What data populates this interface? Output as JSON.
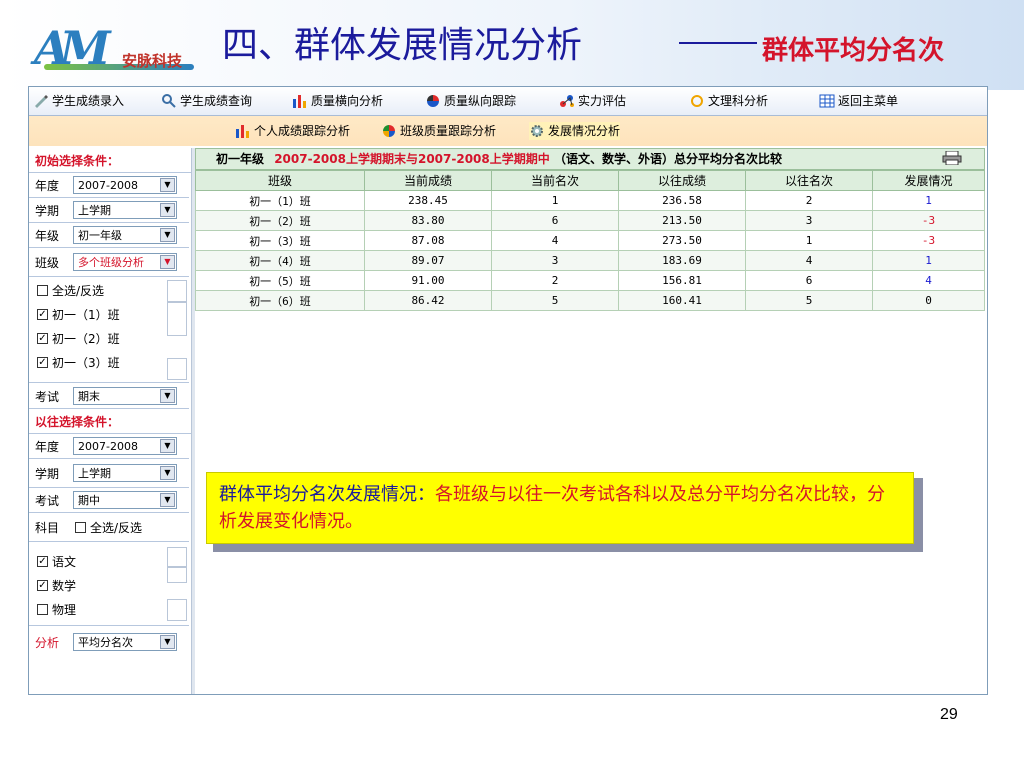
{
  "header": {
    "logo_mark": "AM",
    "logo_text": "安脉科技",
    "title": "四、群体发展情况分析",
    "subtitle": "群体平均分名次"
  },
  "toolbar": {
    "items": [
      {
        "label": "学生成绩录入"
      },
      {
        "label": "学生成绩查询"
      },
      {
        "label": "质量横向分析"
      },
      {
        "label": "质量纵向跟踪"
      },
      {
        "label": "实力评估"
      },
      {
        "label": "文理科分析"
      },
      {
        "label": "返回主菜单"
      }
    ]
  },
  "subtoolbar": {
    "items": [
      {
        "label": "个人成绩跟踪分析"
      },
      {
        "label": "班级质量跟踪分析"
      },
      {
        "label": "发展情况分析"
      }
    ]
  },
  "left": {
    "initial_head": "初始选择条件：",
    "year_label": "年度",
    "year_value": "2007-2008",
    "term_label": "学期",
    "term_value": "上学期",
    "grade_label": "年级",
    "grade_value": "初一年级",
    "class_label": "班级",
    "class_value": "多个班级分析",
    "select_all": "全选/反选",
    "classes": [
      "初一（1）班",
      "初一（2）班",
      "初一（3）班"
    ],
    "exam_label": "考试",
    "exam_value": "期末",
    "prev_head": "以往选择条件：",
    "prev_year_label": "年度",
    "prev_year_value": "2007-2008",
    "prev_term_label": "学期",
    "prev_term_value": "上学期",
    "prev_exam_label": "考试",
    "prev_exam_value": "期中",
    "subject_label": "科目",
    "subject_select_all": "全选/反选",
    "subjects": [
      "语文",
      "数学",
      "物理"
    ],
    "analysis_label": "分析",
    "analysis_value": "平均分名次"
  },
  "result": {
    "caption_grade": "初一年级",
    "caption_range": "2007-2008上学期期末与2007-2008上学期期中",
    "caption_tail": "（语文、数学、外语）总分平均分名次比较",
    "columns": [
      "班级",
      "当前成绩",
      "当前名次",
      "以往成绩",
      "以往名次",
      "发展情况"
    ],
    "rows": [
      {
        "cls": "初一（1）班",
        "cur_score": "238.45",
        "cur_rank": "1",
        "prev_score": "236.58",
        "prev_rank": "2",
        "dev": "1"
      },
      {
        "cls": "初一（2）班",
        "cur_score": "83.80",
        "cur_rank": "6",
        "prev_score": "213.50",
        "prev_rank": "3",
        "dev": "-3"
      },
      {
        "cls": "初一（3）班",
        "cur_score": "87.08",
        "cur_rank": "4",
        "prev_score": "273.50",
        "prev_rank": "1",
        "dev": "-3"
      },
      {
        "cls": "初一（4）班",
        "cur_score": "89.07",
        "cur_rank": "3",
        "prev_score": "183.69",
        "prev_rank": "4",
        "dev": "1"
      },
      {
        "cls": "初一（5）班",
        "cur_score": "91.00",
        "cur_rank": "2",
        "prev_score": "156.81",
        "prev_rank": "6",
        "dev": "4"
      },
      {
        "cls": "初一（6）班",
        "cur_score": "86.42",
        "cur_rank": "5",
        "prev_score": "160.41",
        "prev_rank": "5",
        "dev": "0"
      }
    ]
  },
  "callout": {
    "key": "群体平均分名次发展情况：",
    "value": "各班级与以往一次考试各科以及总分平均分名次比较，分析发展变化情况。"
  },
  "page_number": "29",
  "colors": {
    "title": "#1b1b9c",
    "accent_red": "#d4142b",
    "callout_bg": "#ffff00"
  }
}
